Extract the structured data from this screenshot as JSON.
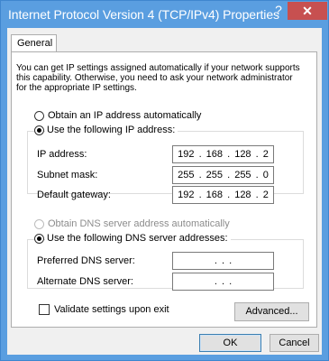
{
  "window": {
    "title": "Internet Protocol Version 4 (TCP/IPv4) Properties",
    "help_glyph": "?",
    "close_glyph": "✕"
  },
  "tabs": [
    {
      "label": "General"
    }
  ],
  "description": "You can get IP settings assigned automatically if your network supports this capability. Otherwise, you need to ask your network administrator for the appropriate IP settings.",
  "ip": {
    "obtain_auto_label": "Obtain an IP address automatically",
    "use_following_label": "Use the following IP address:",
    "ip_address_label": "IP address:",
    "ip_address_value": "192 . 168 . 128 . 2",
    "subnet_label": "Subnet mask:",
    "subnet_value": "255 . 255 . 255 . 0",
    "gateway_label": "Default gateway:",
    "gateway_value": "192 . 168 . 128 . 2",
    "selected": "use_following"
  },
  "dns": {
    "obtain_auto_label": "Obtain DNS server address automatically",
    "use_following_label": "Use the following DNS server addresses:",
    "preferred_label": "Preferred DNS server:",
    "preferred_value": ".   .   .",
    "alternate_label": "Alternate DNS server:",
    "alternate_value": ".   .   .",
    "selected": "use_following"
  },
  "validate_label": "Validate settings upon exit",
  "advanced_label": "Advanced...",
  "ok_label": "OK",
  "cancel_label": "Cancel",
  "colors": {
    "titlebar": "#5a9ee0",
    "close": "#c75050"
  }
}
